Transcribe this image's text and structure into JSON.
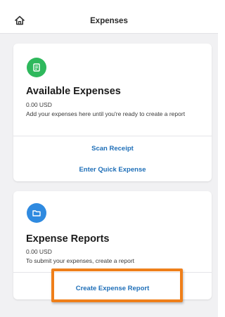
{
  "header": {
    "title": "Expenses",
    "home_icon": "home-icon"
  },
  "available": {
    "icon": "receipt-icon",
    "icon_color": "#2eb85c",
    "title": "Available Expenses",
    "amount": "0.00 USD",
    "description": "Add your expenses here until you're ready to create a report",
    "actions": {
      "scan": "Scan Receipt",
      "quick": "Enter Quick Expense"
    }
  },
  "reports": {
    "icon": "folder-icon",
    "icon_color": "#2f8ae0",
    "title": "Expense Reports",
    "amount": "0.00 USD",
    "description": "To submit your expenses, create a report",
    "actions": {
      "create": "Create Expense Report"
    }
  },
  "colors": {
    "link": "#1f6fb8",
    "highlight": "#ef7f1a",
    "background": "#f1f1f3"
  }
}
